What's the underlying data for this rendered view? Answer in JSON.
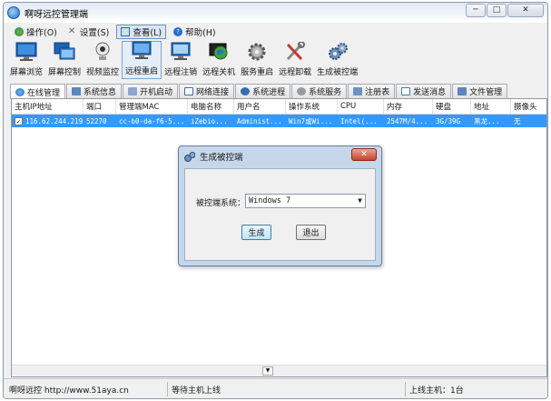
{
  "window": {
    "title": "啊呀远控管理端",
    "caption_buttons": [
      "─",
      "□",
      "✕"
    ]
  },
  "menu": [
    {
      "label": "操作(O)",
      "icon": "operation-icon",
      "color": "#2f7a2f"
    },
    {
      "label": "设置(S)",
      "icon": "tools-icon",
      "color": "#777777"
    },
    {
      "label": "查看(L)",
      "icon": "view-icon",
      "color": "#2a64b5"
    },
    {
      "label": "帮助(H)",
      "icon": "help-icon",
      "color": "#1f6fd1"
    }
  ],
  "toolbar": [
    {
      "label": "屏幕浏览",
      "icon": "monitor-icon"
    },
    {
      "label": "屏幕控制",
      "icon": "screen-control-icon"
    },
    {
      "label": "视频监控",
      "icon": "webcam-icon"
    },
    {
      "label": "远程重启",
      "icon": "restart-monitor-icon"
    },
    {
      "label": "远程注销",
      "icon": "logoff-monitor-icon"
    },
    {
      "label": "远程关机",
      "icon": "shutdown-globe-icon"
    },
    {
      "label": "服务重启",
      "icon": "gear-icon"
    },
    {
      "label": "远程卸载",
      "icon": "wrench-icon"
    },
    {
      "label": "生成被控端",
      "icon": "gears-icon"
    }
  ],
  "tabs": [
    {
      "label": "在线管理",
      "icon": "online-icon"
    },
    {
      "label": "系统信息",
      "icon": "sysinfo-icon"
    },
    {
      "label": "开机启动",
      "icon": "startup-icon"
    },
    {
      "label": "网络连接",
      "icon": "network-icon"
    },
    {
      "label": "系统进程",
      "icon": "process-icon"
    },
    {
      "label": "系统服务",
      "icon": "service-icon"
    },
    {
      "label": "注册表",
      "icon": "registry-icon"
    },
    {
      "label": "发送消息",
      "icon": "message-icon"
    },
    {
      "label": "文件管理",
      "icon": "file-icon"
    }
  ],
  "table": {
    "columns": [
      "主机IP地址",
      "端口",
      "管理端MAC",
      "电脑名称",
      "用户名",
      "操作系统",
      "CPU",
      "内存",
      "硬盘",
      "地址",
      "摄像头"
    ],
    "rows": [
      [
        "116.62.244.219",
        "52270",
        "cc-b0-da-f6-5...",
        "iZebio...",
        "Administ...",
        "Win7或Wi...",
        "Intel(...",
        "2547M/4...",
        "3G/39G",
        "黑龙...",
        "无"
      ]
    ]
  },
  "status": {
    "left": "啊呀远控 http://www.51aya.cn",
    "middle": "等待主机上线",
    "right": "上线主机：1台"
  },
  "dialog": {
    "title": "生成被控端",
    "close": "✕",
    "os_label": "被控端系统：",
    "os_value": "Windows 7",
    "generate": "生成",
    "exit": "退出"
  }
}
